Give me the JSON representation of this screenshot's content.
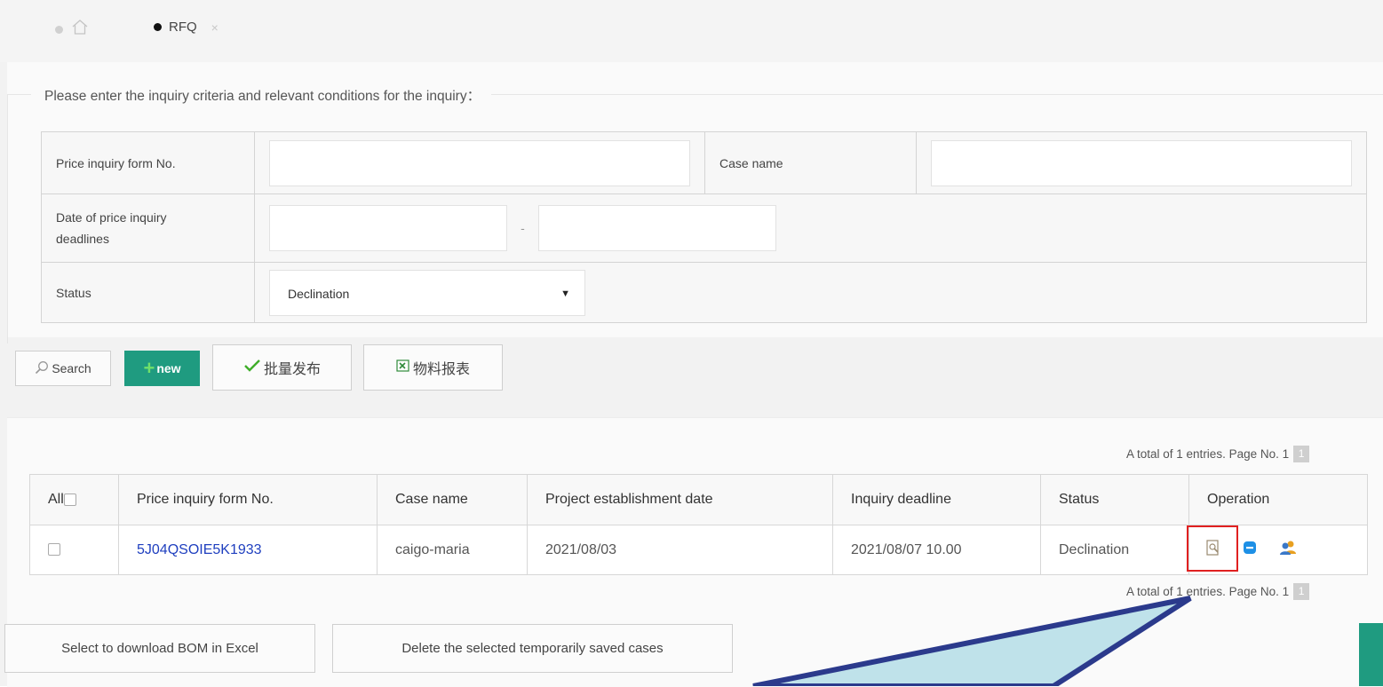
{
  "tabs": {
    "home_icon": "home-icon",
    "active_label": "RFQ",
    "close_glyph": "×"
  },
  "criteria": {
    "legend": "Please enter the inquiry criteria and relevant conditions for the inquiry：",
    "form_no_label": "Price inquiry form No.",
    "form_no_value": "",
    "case_name_label": "Case name",
    "case_name_value": "",
    "deadline_label_line1": "Date of price inquiry",
    "deadline_label_line2": "deadlines",
    "deadline_from": "",
    "deadline_separator": "-",
    "deadline_to": "",
    "status_label": "Status",
    "status_selected": "Declination"
  },
  "toolbar": {
    "search_label": "Search",
    "new_label": "new",
    "batch_publish_label": "批量发布",
    "material_report_label": "物料报表"
  },
  "pager": {
    "prefix": "A total of 1 entries. Page No. 1",
    "current_page": "1"
  },
  "table": {
    "headers": {
      "all": "All",
      "form_no": "Price inquiry form No.",
      "case_name": "Case name",
      "established": "Project establishment date",
      "deadline": "Inquiry deadline",
      "status": "Status",
      "operation": "Operation"
    },
    "rows": [
      {
        "form_no": "5J04QSOIE5K1933",
        "case_name": "caigo-maria",
        "established": "2021/08/03",
        "deadline": "2021/08/07 10.00",
        "status": "Declination"
      }
    ]
  },
  "footer_buttons": {
    "download_bom": "Select to download BOM in Excel",
    "delete_saved": "Delete the selected temporarily saved cases"
  },
  "colors": {
    "accent_green": "#1f9b80",
    "link_blue": "#1f3fbf",
    "highlight_red": "#e02020",
    "callout_fill": "#bfe2ea",
    "callout_stroke": "#2b3a8c"
  }
}
